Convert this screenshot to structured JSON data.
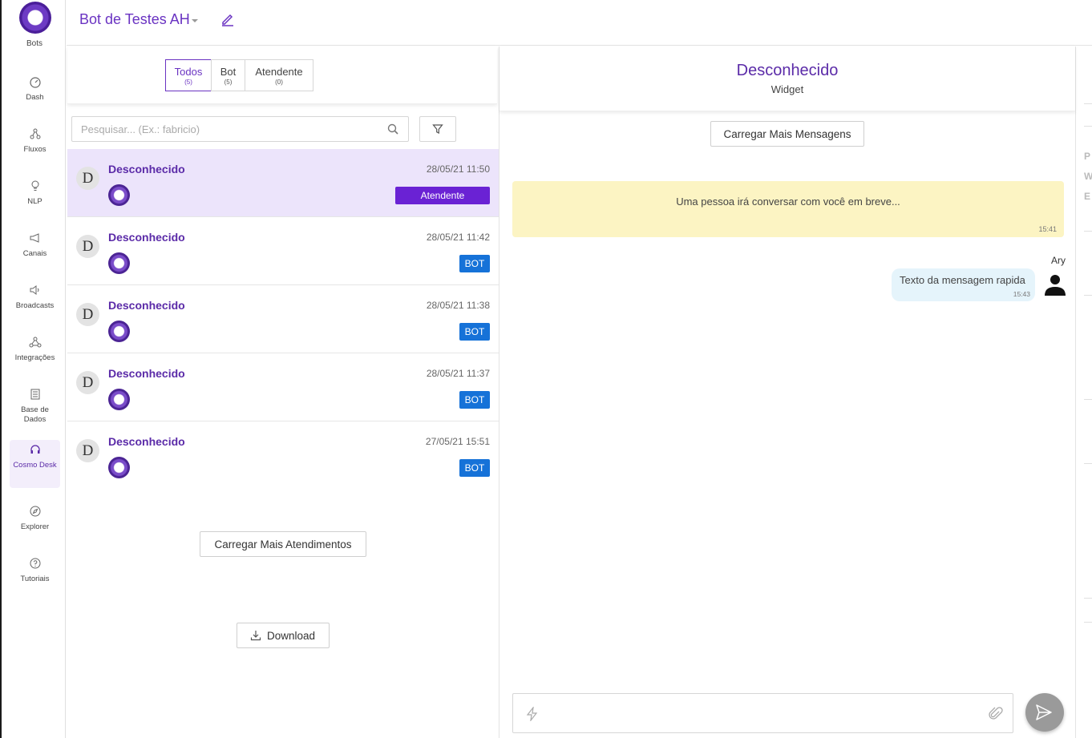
{
  "sidebar": {
    "logo_label": "Bots",
    "items": [
      {
        "label": "Dash",
        "icon": "gauge-icon"
      },
      {
        "label": "Fluxos",
        "icon": "flow-icon"
      },
      {
        "label": "NLP",
        "icon": "lightbulb-icon"
      },
      {
        "label": "Canais",
        "icon": "megaphone-icon"
      },
      {
        "label": "Broadcasts",
        "icon": "broadcast-icon"
      },
      {
        "label": "Integrações",
        "icon": "integration-icon"
      },
      {
        "label": "Base de Dados",
        "icon": "database-icon"
      },
      {
        "label": "Cosmo Desk",
        "icon": "headset-icon"
      },
      {
        "label": "Explorer",
        "icon": "compass-icon"
      },
      {
        "label": "Tutoriais",
        "icon": "help-icon"
      }
    ],
    "active": "Cosmo Desk"
  },
  "header": {
    "bot_name": "Bot de Testes AH"
  },
  "tabs": [
    {
      "label": "Todos",
      "count": "(5)"
    },
    {
      "label": "Bot",
      "count": "(5)"
    },
    {
      "label": "Atendente",
      "count": "(0)"
    }
  ],
  "search": {
    "placeholder": "Pesquisar... (Ex.: fabricio)"
  },
  "conversations": [
    {
      "initial": "D",
      "name": "Desconhecido",
      "date": "28/05/21 11:50",
      "badge": "Atendente"
    },
    {
      "initial": "D",
      "name": "Desconhecido",
      "date": "28/05/21 11:42",
      "badge": "BOT"
    },
    {
      "initial": "D",
      "name": "Desconhecido",
      "date": "28/05/21 11:38",
      "badge": "BOT"
    },
    {
      "initial": "D",
      "name": "Desconhecido",
      "date": "28/05/21 11:37",
      "badge": "BOT"
    },
    {
      "initial": "D",
      "name": "Desconhecido",
      "date": "27/05/21 15:51",
      "badge": "BOT"
    }
  ],
  "list_actions": {
    "load_more": "Carregar Mais Atendimentos",
    "download": "Download"
  },
  "chat": {
    "contact_name": "Desconhecido",
    "channel": "Widget",
    "load_more": "Carregar Mais Mensagens",
    "system_message": {
      "text": "Uma pessoa irá conversar com você em breve...",
      "time": "15:41"
    },
    "agent_message": {
      "sender": "Ary",
      "text": "Texto da mensagem rapida",
      "time": "15:43"
    }
  },
  "right_panel_fragment": [
    "P",
    "W",
    "E"
  ],
  "colors": {
    "brand": "#6a33c2",
    "attendant_badge": "#6a22d4",
    "bot_badge": "#1672d8",
    "notice_bg": "#fcf4c3",
    "bubble_bg": "#e5f4fb"
  }
}
